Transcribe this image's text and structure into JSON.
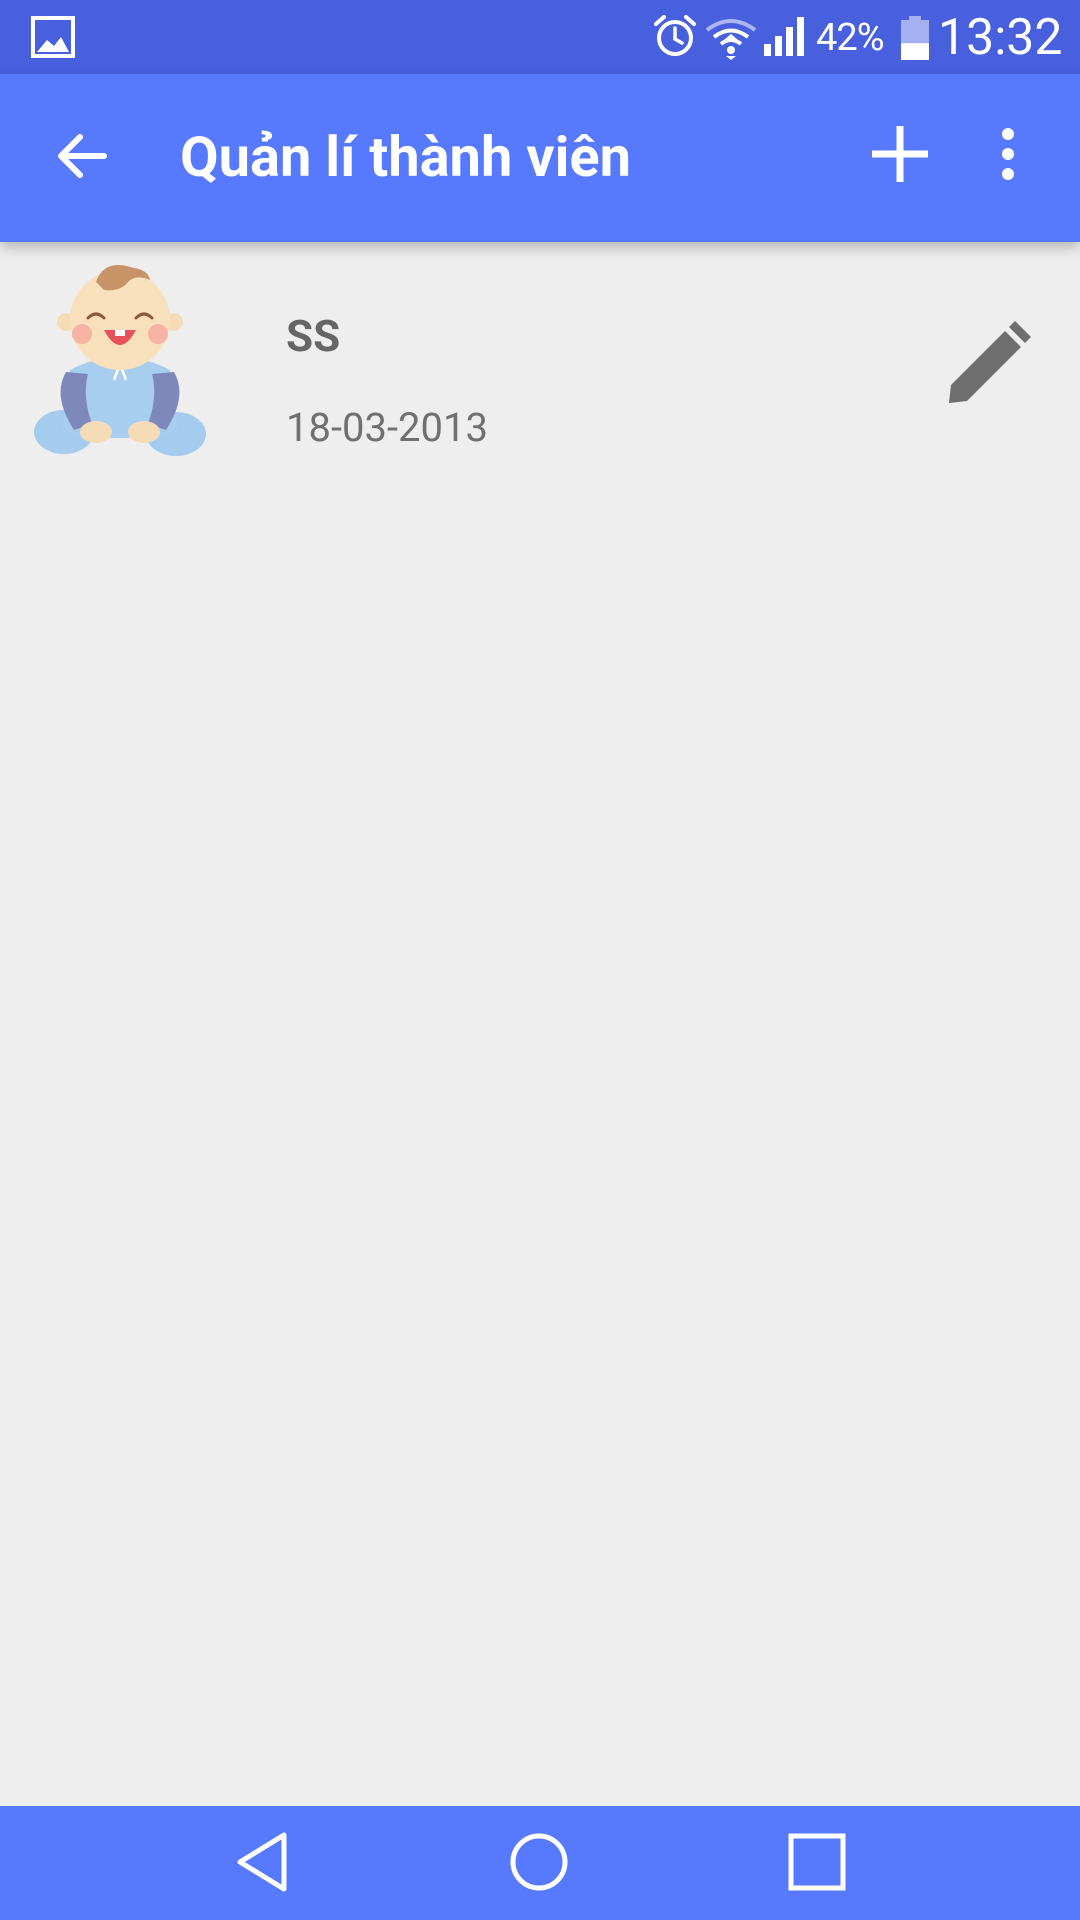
{
  "status_bar": {
    "battery_percent": "42%",
    "time": "13:32",
    "battery_level": 0.42,
    "icons": [
      "gallery-icon",
      "alarm-icon",
      "wifi-icon",
      "signal-icon",
      "battery-icon"
    ]
  },
  "app_bar": {
    "title": "Quản lí thành viên",
    "icons": [
      "back-arrow-icon",
      "add-icon",
      "more-vert-icon"
    ]
  },
  "members": [
    {
      "name": "SS",
      "date": "18-03-2013",
      "icons": [
        "baby-avatar",
        "edit-pencil-icon"
      ]
    }
  ],
  "nav_bar": {
    "icons": [
      "nav-back-icon",
      "nav-home-icon",
      "nav-recents-icon"
    ]
  },
  "colors": {
    "status_bar": "#4860de",
    "app_bar": "#5779fe",
    "background": "#eeeeee",
    "primary_text": "#666666",
    "icon_grey": "#6e6e6e"
  }
}
